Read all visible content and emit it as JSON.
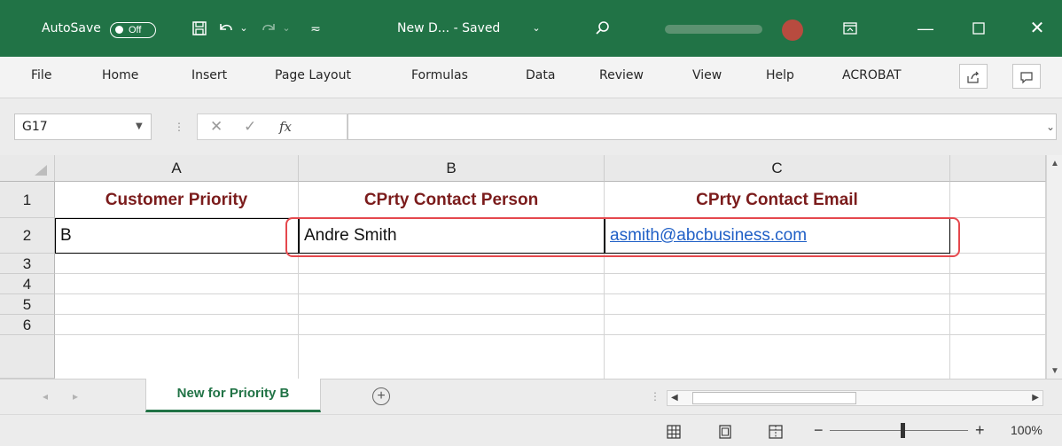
{
  "titlebar": {
    "autosave_label": "AutoSave",
    "autosave_state": "Off",
    "doc_title": "New D...  -  Saved",
    "icons": [
      "save-icon",
      "undo-icon",
      "redo-icon",
      "customize-qat-icon",
      "search-icon",
      "ribbon-display-icon",
      "minimize-icon",
      "maximize-icon",
      "close-icon"
    ]
  },
  "ribbon": {
    "tabs": [
      "File",
      "Home",
      "Insert",
      "Page Layout",
      "Formulas",
      "Data",
      "Review",
      "View",
      "Help",
      "ACROBAT"
    ]
  },
  "formula_bar": {
    "name_box": "G17",
    "fx_label": "fx",
    "content": ""
  },
  "grid": {
    "columns": [
      "A",
      "B",
      "C"
    ],
    "rows": [
      "1",
      "2",
      "3",
      "4",
      "5",
      "6"
    ],
    "headers": [
      "Customer Priority",
      "CPrty Contact Person",
      "CPrty Contact Email"
    ],
    "row2": [
      "B",
      "Andre Smith",
      "asmith@abcbusiness.com"
    ]
  },
  "sheet": {
    "tab_name": "New for Priority B"
  },
  "status": {
    "zoom": "100%",
    "zoom_minus": "−",
    "zoom_plus": "+"
  },
  "colors": {
    "title_green": "#217346",
    "header_text": "#7b1c1c",
    "link": "#1f5fc6",
    "highlight": "#e5484d"
  }
}
